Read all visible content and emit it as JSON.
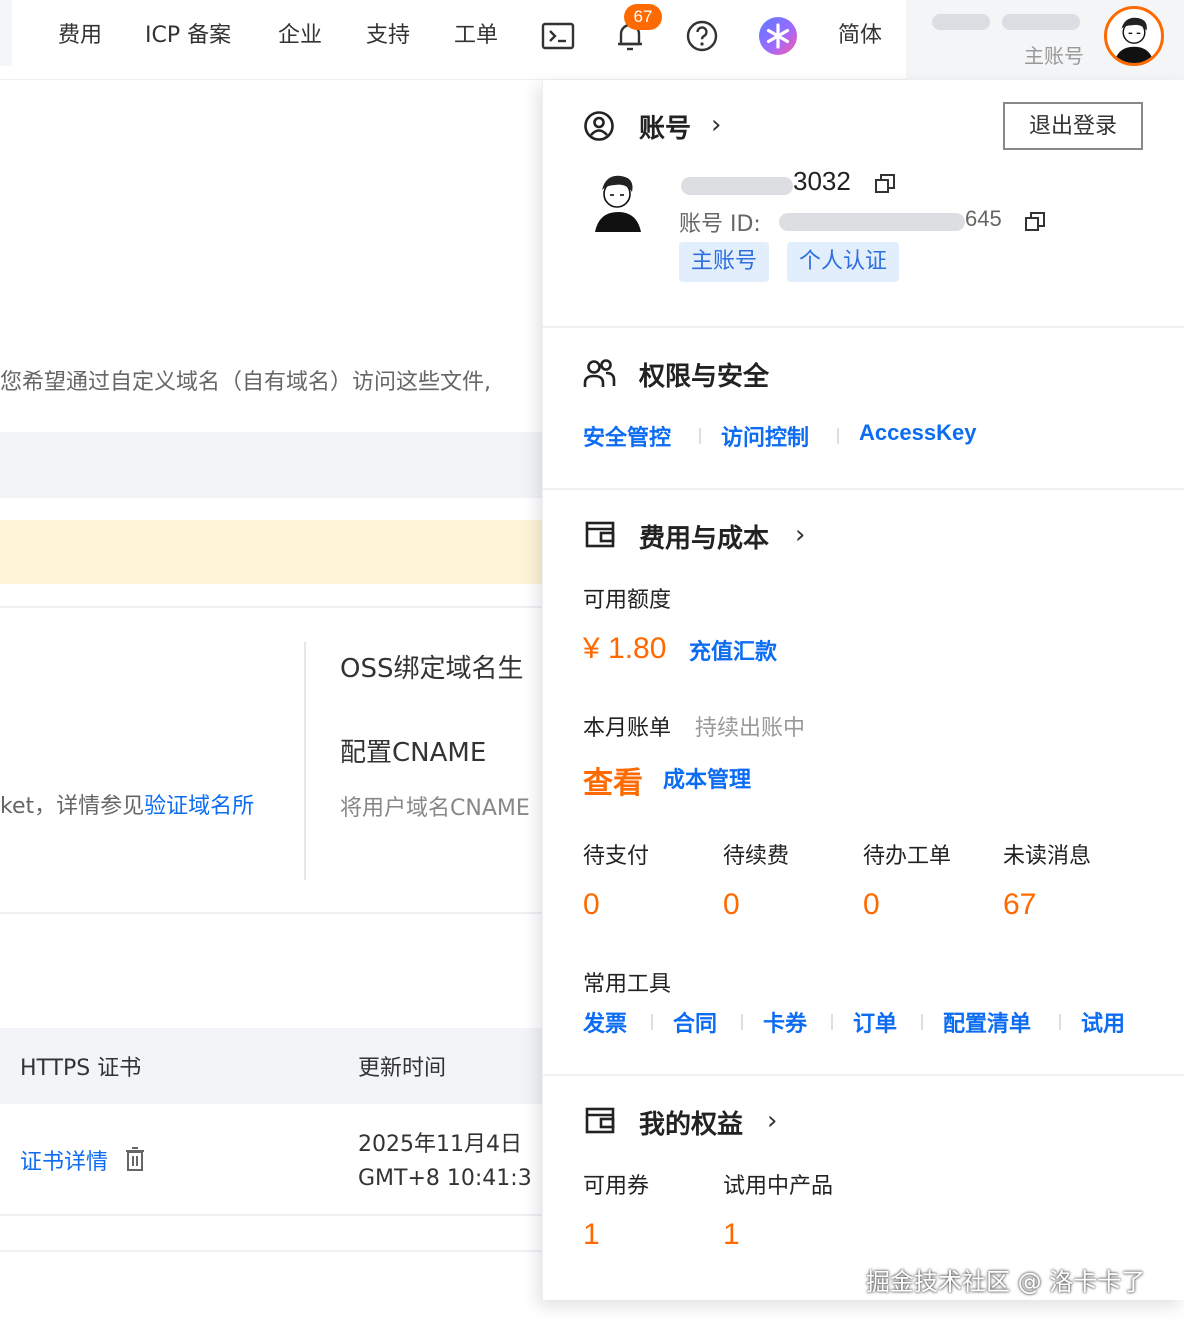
{
  "nav": {
    "items": [
      "费用",
      "ICP 备案",
      "企业",
      "支持",
      "工单"
    ],
    "notification_count": "67",
    "language": "简体",
    "user_role": "主账号"
  },
  "background": {
    "desc_text": "您希望通过自定义域名（自有域名）访问这些文件,",
    "section_title": "OSS绑定域名生",
    "config_title": "配置CNAME",
    "config_desc": "将用户域名CNAME",
    "verify_prefix": "ket，详情参见",
    "verify_link": "验证域名所",
    "table_headers": [
      "HTTPS 证书",
      "更新时间"
    ],
    "cert_detail_link": "证书详情",
    "update_date": "2025年11月4日",
    "update_time": "GMT+8 10:41:3"
  },
  "account": {
    "title": "账号",
    "logout": "退出登录",
    "name_suffix": "3032",
    "id_label": "账号 ID:",
    "id_suffix": "645",
    "tags": [
      "主账号",
      "个人认证"
    ]
  },
  "security": {
    "title": "权限与安全",
    "links": [
      "安全管控",
      "访问控制",
      "AccessKey"
    ]
  },
  "cost": {
    "title": "费用与成本",
    "balance_label": "可用额度",
    "balance": "¥ 1.80",
    "recharge": "充值汇款",
    "bill_label": "本月账单",
    "bill_status": "持续出账中",
    "view": "查看",
    "cost_manage": "成本管理",
    "stats": [
      {
        "label": "待支付",
        "value": "0"
      },
      {
        "label": "待续费",
        "value": "0"
      },
      {
        "label": "待办工单",
        "value": "0"
      },
      {
        "label": "未读消息",
        "value": "67"
      }
    ],
    "tools_label": "常用工具",
    "tools": [
      "发票",
      "合同",
      "卡券",
      "订单",
      "配置清单",
      "试用"
    ]
  },
  "benefits": {
    "title": "我的权益",
    "stats": [
      {
        "label": "可用券",
        "value": "1"
      },
      {
        "label": "试用中产品",
        "value": "1"
      }
    ]
  },
  "watermark": "掘金技术社区 @ 洛卡卡了"
}
